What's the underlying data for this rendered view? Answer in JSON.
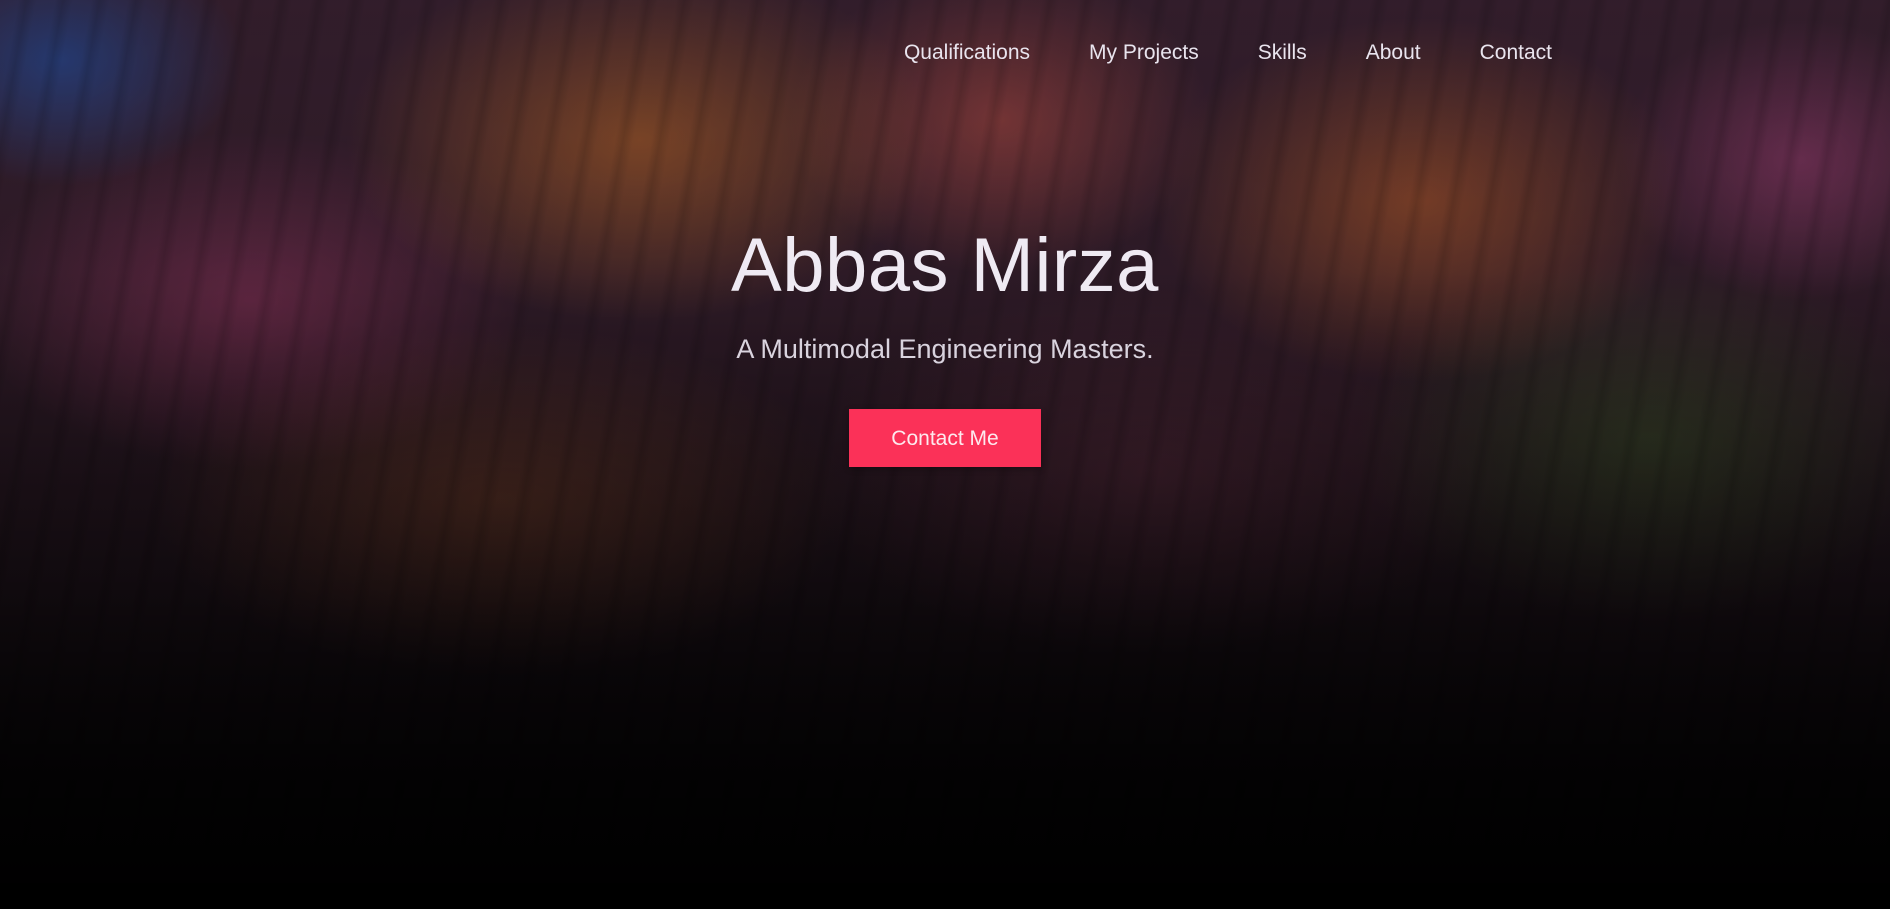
{
  "nav": {
    "items": [
      {
        "label": "Qualifications"
      },
      {
        "label": "My Projects"
      },
      {
        "label": "Skills"
      },
      {
        "label": "About"
      },
      {
        "label": "Contact"
      }
    ]
  },
  "hero": {
    "title": "Abbas Mirza",
    "subtitle": "A Multimodal Engineering Masters.",
    "cta_label": "Contact Me"
  },
  "colors": {
    "accent": "#fb3158",
    "text": "#ece8f2"
  }
}
